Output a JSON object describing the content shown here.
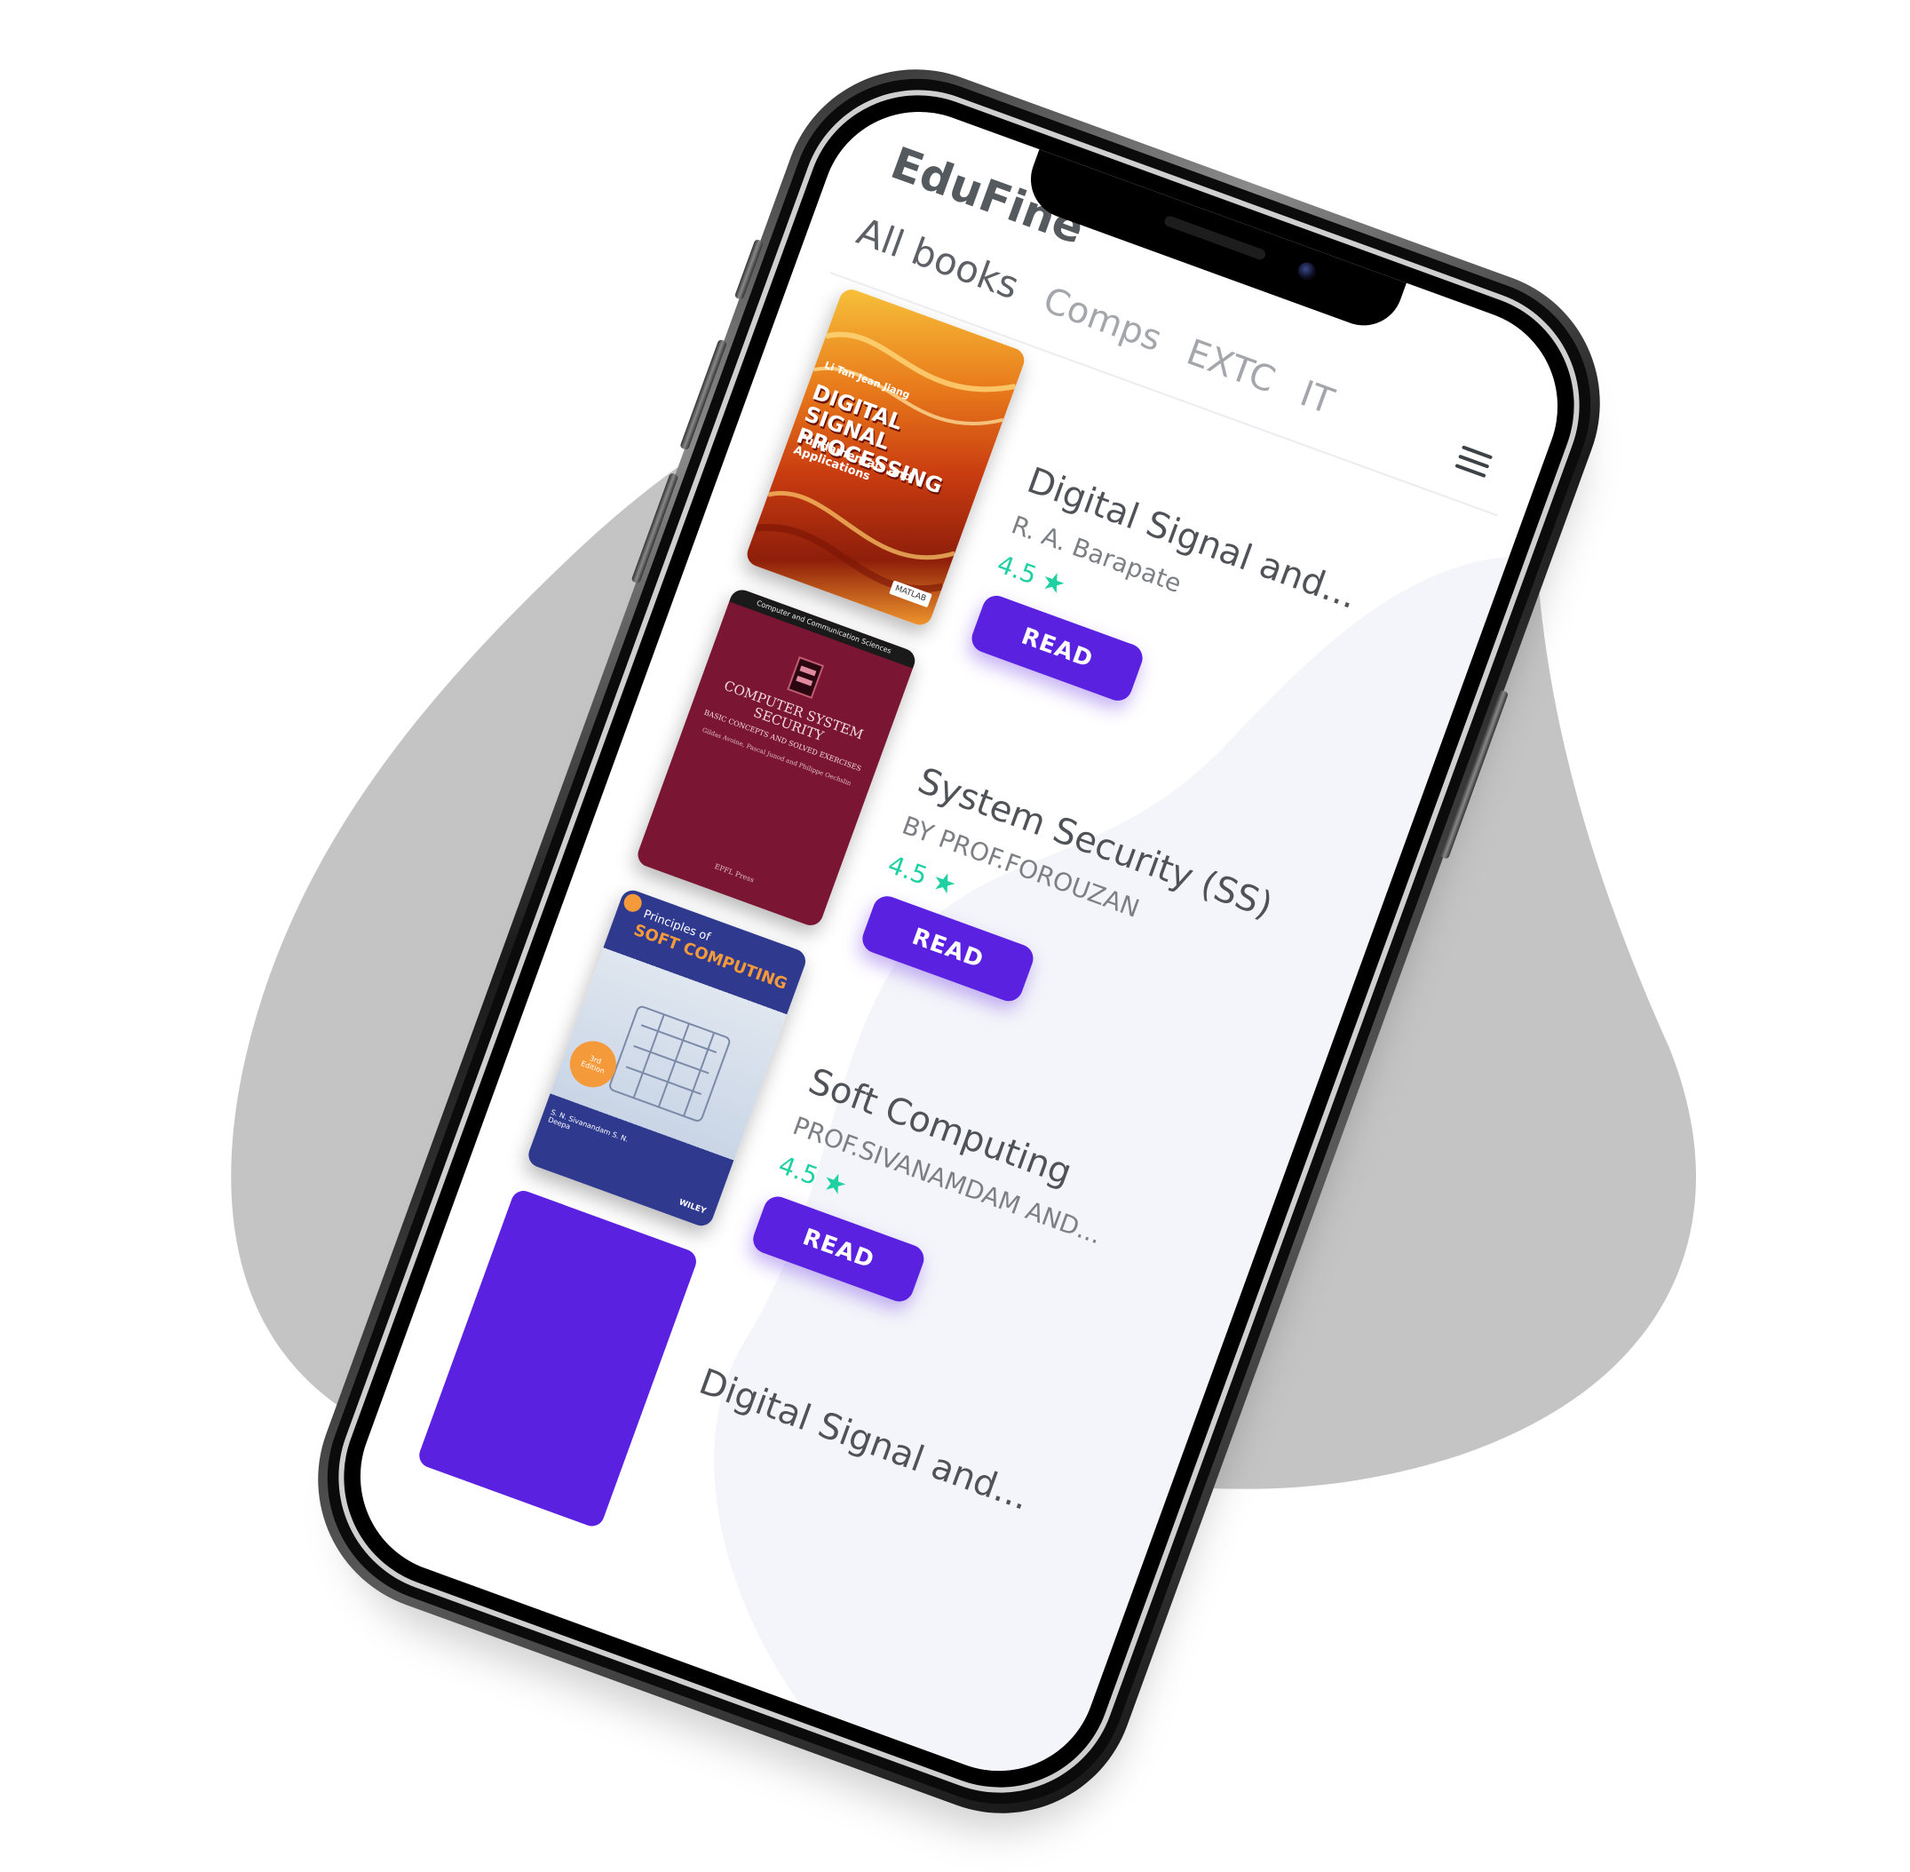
{
  "app": {
    "title": "EduFine"
  },
  "tabs": [
    {
      "label": "All books",
      "active": true
    },
    {
      "label": "Comps",
      "active": false
    },
    {
      "label": "EXTC",
      "active": false
    },
    {
      "label": "IT",
      "active": false
    }
  ],
  "books": [
    {
      "title": "Digital Signal and...",
      "author": "R. A. Barapate",
      "rating": "4.5",
      "read_label": "READ",
      "cover": {
        "top_text": "Li Tan  Jean Jiang",
        "main_text": "DIGITAL SIGNAL PROCESSING",
        "sub_text": "Fundamentals and Applications",
        "badge": "MATLAB"
      }
    },
    {
      "title": "System Security (SS)",
      "author": "BY PROF.FOROUZAN",
      "rating": "4.5",
      "read_label": "READ",
      "cover": {
        "top_text": "Computer and Communication Sciences",
        "main_text": "COMPUTER SYSTEM SECURITY",
        "sub_text": "BASIC CONCEPTS AND SOLVED EXERCISES",
        "authors": "Gildas Avoine, Pascal Junod and Philippe Oechslin",
        "publisher": "EPFL Press"
      }
    },
    {
      "title": "Soft Computing",
      "author": "PROF.SIVANAMDAM AND...",
      "rating": "4.5",
      "read_label": "READ",
      "cover": {
        "top_text": "Principles of",
        "main_text": "SOFT COMPUTING",
        "edition": "3rd Edition",
        "authors": "S. N. Sivanandam  S. N. Deepa",
        "publisher": "WILEY"
      }
    },
    {
      "title": "Digital Signal and..."
    }
  ],
  "colors": {
    "accent": "#5b21e0",
    "rating": "#1fd1a2",
    "blob": "#c4c4c4"
  }
}
